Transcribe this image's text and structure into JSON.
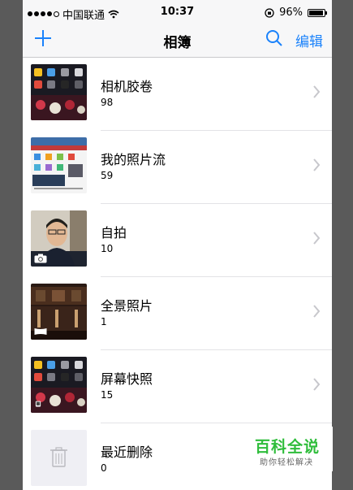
{
  "status_bar": {
    "carrier": "中国联通",
    "time": "10:37",
    "battery": "96%",
    "battery_level": 0.96
  },
  "nav": {
    "title": "相簿",
    "edit_label": "编辑",
    "add_icon": "plus-icon",
    "search_icon": "search-icon"
  },
  "albums": [
    {
      "name": "相机胶卷",
      "count": "98"
    },
    {
      "name": "我的照片流",
      "count": "59"
    },
    {
      "name": "自拍",
      "count": "10"
    },
    {
      "name": "全景照片",
      "count": "1"
    },
    {
      "name": "屏幕快照",
      "count": "15"
    },
    {
      "name": "最近删除",
      "count": "0"
    }
  ],
  "watermark": {
    "main": "百科全说",
    "sub": "助你轻松解决"
  },
  "colors": {
    "accent": "#1a82fb",
    "watermark_green": "#2fbd3b"
  }
}
